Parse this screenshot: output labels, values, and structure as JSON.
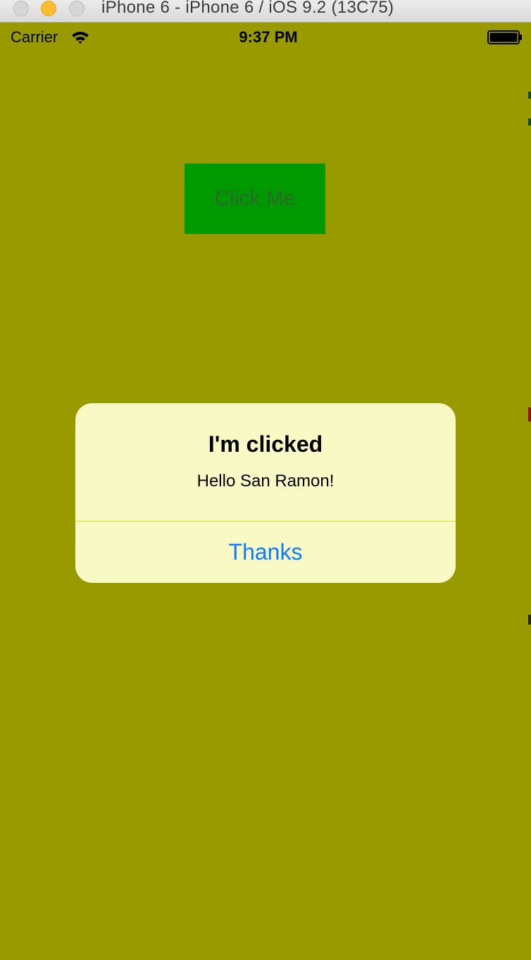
{
  "window": {
    "title": "iPhone 6 - iPhone 6 / iOS 9.2 (13C75)"
  },
  "status_bar": {
    "carrier": "Carrier",
    "time": "9:37 PM",
    "wifi_icon": "wifi-icon",
    "battery_icon": "battery-icon"
  },
  "main": {
    "button_label": "Click Me",
    "background_color": "#999a00",
    "button_color": "#009900"
  },
  "alert": {
    "title": "I'm clicked",
    "message": "Hello San Ramon!",
    "action_label": "Thanks",
    "action_color": "#0a7aff",
    "background_color": "#f9f9c5"
  }
}
